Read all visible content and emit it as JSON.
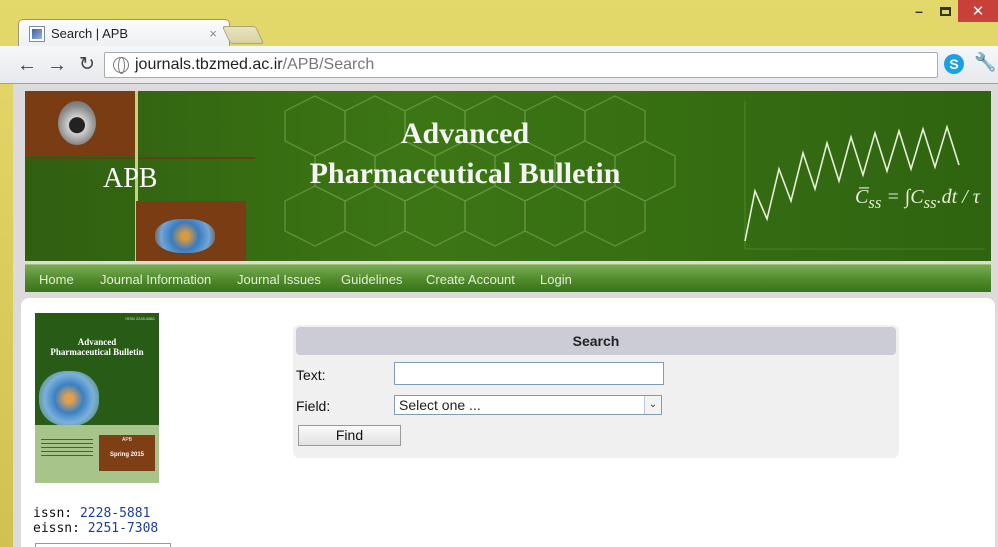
{
  "browser": {
    "tab_title": "Search | APB",
    "tab_close": "×",
    "url_domain": "journals.tbzmed.ac.ir",
    "url_path": "/APB/Search",
    "window_buttons": {
      "minimize": "–",
      "close": "✕"
    },
    "icons": [
      "back-arrow-icon",
      "forward-arrow-icon",
      "reload-icon",
      "globe-icon",
      "star-icon",
      "skype-icon",
      "wrench-icon"
    ],
    "colors": {
      "frame": "#d3c45a",
      "close_button": "#c8403a"
    }
  },
  "banner": {
    "short_name": "APB",
    "title_line1": "Advanced",
    "title_line2": "Pharmaceutical Bulletin",
    "colors": {
      "green": "#3c7614",
      "brown": "#7a3d13"
    }
  },
  "nav": {
    "items": [
      "Home",
      "Journal Information",
      "Journal Issues",
      "Guidelines",
      "Create Account",
      "Login"
    ]
  },
  "sidebar": {
    "cover_title_line1": "Advanced",
    "cover_title_line2": "Pharmaceutical Bulletin",
    "cover_season": "Spring 2015",
    "cover_box_label": "APB",
    "issn_label": "issn:",
    "issn_value": "2228-5881",
    "eissn_label": "eissn:",
    "eissn_value": "2251-7308"
  },
  "search": {
    "heading": "Search",
    "text_label": "Text:",
    "text_value": "",
    "field_label": "Field:",
    "field_selected": "Select one ...",
    "find_label": "Find"
  }
}
